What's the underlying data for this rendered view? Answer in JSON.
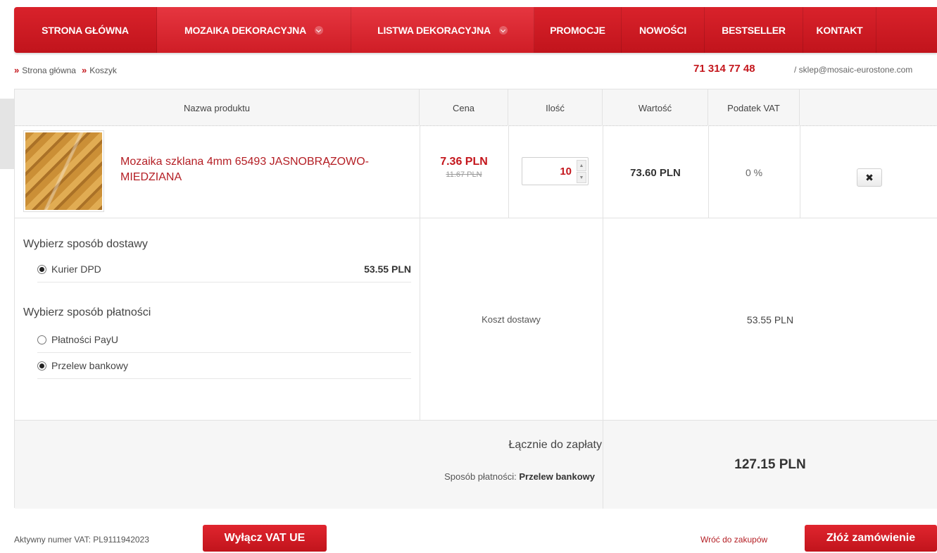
{
  "nav": {
    "items": [
      {
        "label": "STRONA GŁÓWNA",
        "dropdown": false
      },
      {
        "label": "MOZAIKA DEKORACYJNA",
        "dropdown": true
      },
      {
        "label": "LISTWA DEKORACYJNA",
        "dropdown": true
      },
      {
        "label": "PROMOCJE",
        "dropdown": false
      },
      {
        "label": "NOWOŚCI",
        "dropdown": false
      },
      {
        "label": "BESTSELLER",
        "dropdown": false
      },
      {
        "label": "KONTAKT",
        "dropdown": false
      }
    ]
  },
  "breadcrumb": {
    "items": [
      "Strona główna",
      "Koszyk"
    ],
    "separator": "»"
  },
  "contact": {
    "phone": "71 314 77 48",
    "email": "/ sklep@mosaic-eurostone.com"
  },
  "table": {
    "headers": [
      "Nazwa produktu",
      "Cena",
      "Ilość",
      "Wartość",
      "Podatek VAT"
    ]
  },
  "cart_item": {
    "name": "Mozaika szklana 4mm 65493 JASNOBRĄZOWO-MIEDZIANA",
    "price": "7.36 PLN",
    "old_price": "11.67 PLN",
    "quantity": "10",
    "value": "73.60 PLN",
    "vat": "0 %"
  },
  "delivery": {
    "title": "Wybierz sposób dostawy",
    "options": [
      {
        "label": "Kurier DPD",
        "price": "53.55 PLN",
        "selected": true
      }
    ]
  },
  "payment": {
    "title": "Wybierz sposób płatności",
    "options": [
      {
        "label": "Płatności PayU",
        "selected": false
      },
      {
        "label": "Przelew bankowy",
        "selected": true
      }
    ]
  },
  "shipping_cost": {
    "label": "Koszt dostawy",
    "value": "53.55 PLN"
  },
  "total": {
    "label": "Łącznie do zapłaty",
    "payment_method_label": "Sposób płatności:",
    "payment_method_value": "Przelew bankowy",
    "value": "127.15 PLN"
  },
  "footer": {
    "vat_number": "Aktywny numer VAT: PL9111942023",
    "vat_button": "Wyłącz VAT UE",
    "back_link": "Wróć do zakupów",
    "order_button": "Złóż zamówienie"
  },
  "colors": {
    "brand_red": "#c4161c",
    "link_red": "#b41e24"
  }
}
